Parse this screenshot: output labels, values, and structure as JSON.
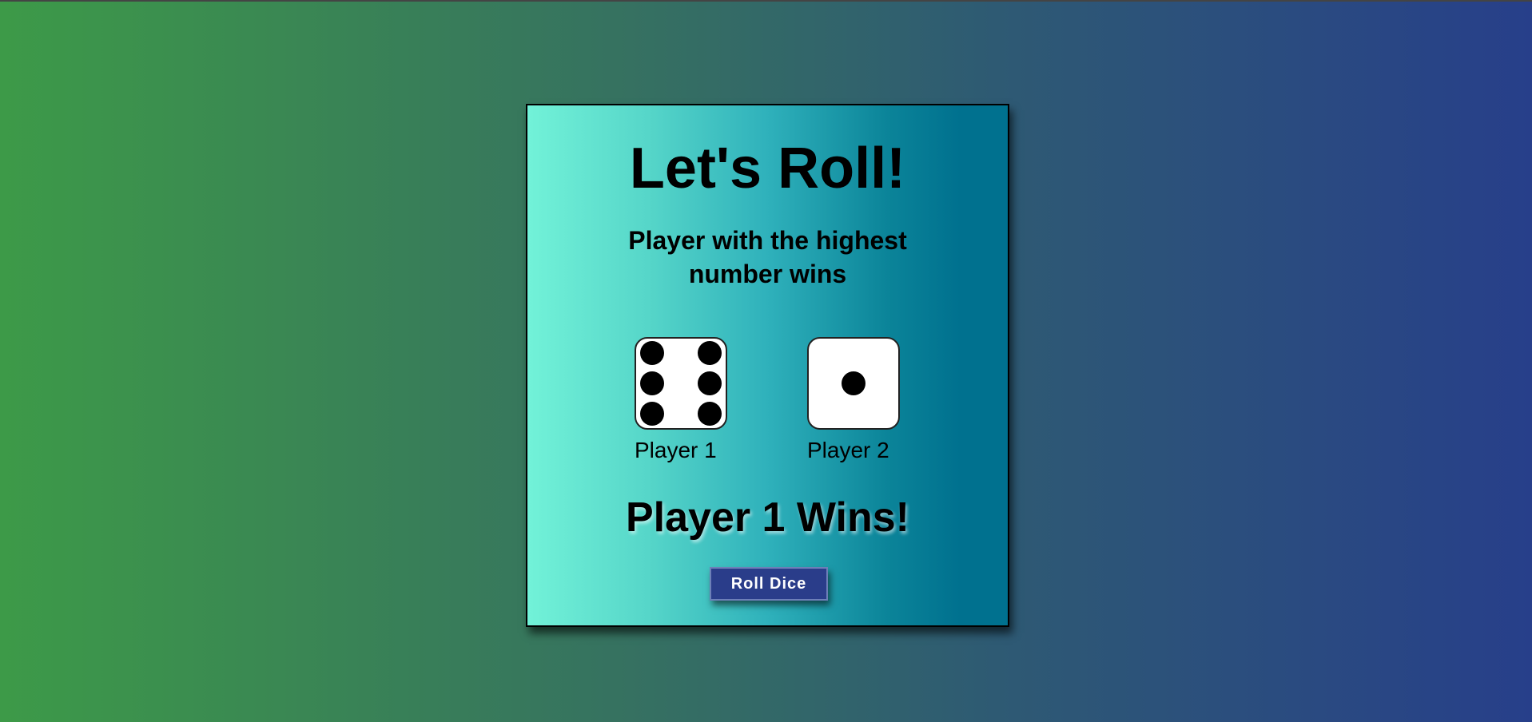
{
  "game": {
    "title": "Let's Roll!",
    "subtitle": "Player with the highest number wins",
    "players": [
      {
        "label": "Player 1",
        "die_value": 6
      },
      {
        "label": "Player 2",
        "die_value": 1
      }
    ],
    "result": "Player 1 Wins!",
    "roll_button_label": "Roll Dice"
  },
  "colors": {
    "button_bg": "#2a3d8a",
    "card_gradient_start": "#72f2d8",
    "card_gradient_end": "#00718f",
    "page_gradient_start": "#3d9a48",
    "page_gradient_end": "#273f8a"
  }
}
